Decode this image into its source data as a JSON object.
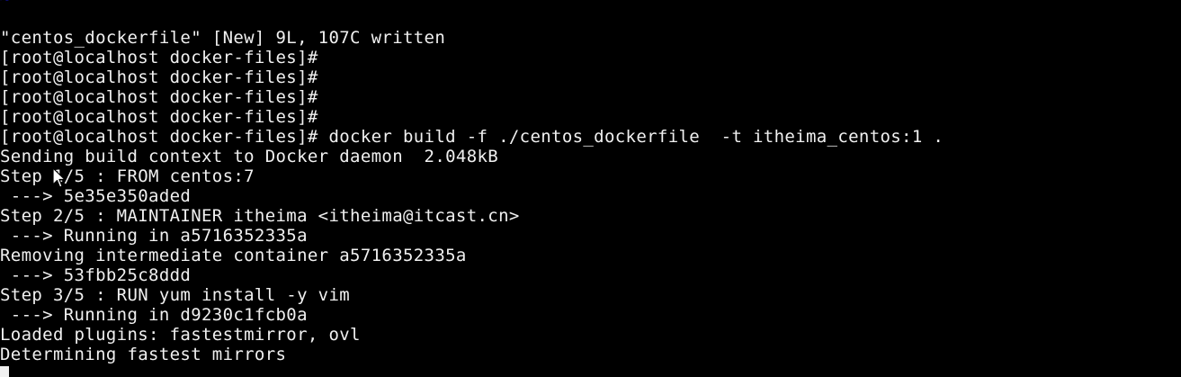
{
  "terminal": {
    "tilde": "~",
    "lines": [
      "\"centos_dockerfile\" [New] 9L, 107C written",
      "[root@localhost docker-files]#",
      "[root@localhost docker-files]#",
      "[root@localhost docker-files]#",
      "[root@localhost docker-files]#",
      "[root@localhost docker-files]# docker build -f ./centos_dockerfile  -t itheima_centos:1 .",
      "Sending build context to Docker daemon  2.048kB",
      "Step 1/5 : FROM centos:7",
      " ---> 5e35e350aded",
      "Step 2/5 : MAINTAINER itheima <itheima@itcast.cn>",
      " ---> Running in a5716352335a",
      "Removing intermediate container a5716352335a",
      " ---> 53fbb25c8ddd",
      "Step 3/5 : RUN yum install -y vim",
      " ---> Running in d9230c1fcb0a",
      "Loaded plugins: fastestmirror, ovl",
      "Determining fastest mirrors"
    ],
    "colors": {
      "background": "#000000",
      "foreground": "#f0f0f0",
      "tilde": "#1a1aff"
    },
    "mouse_pointer_icon": "arrow-cursor-icon"
  }
}
